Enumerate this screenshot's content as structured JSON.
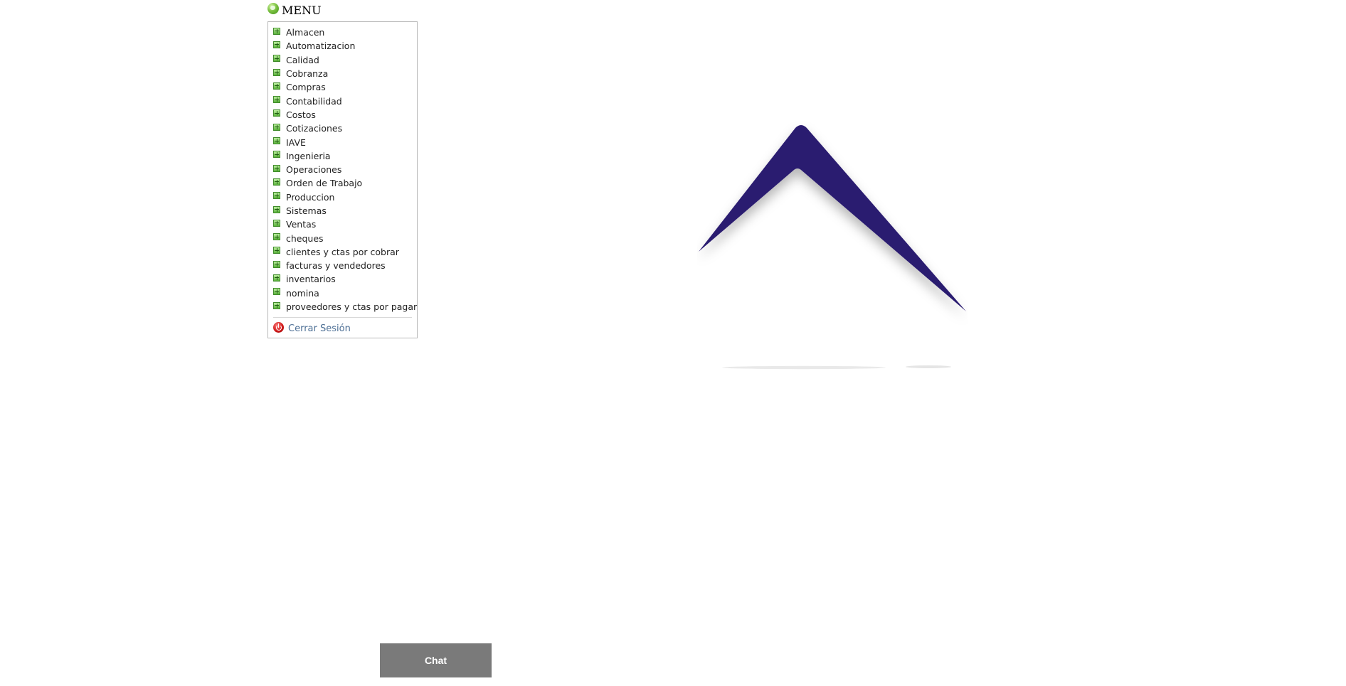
{
  "menu": {
    "title": "MENU",
    "items": [
      "Almacen",
      "Automatizacion",
      "Calidad",
      "Cobranza",
      "Compras",
      "Contabilidad",
      "Costos",
      "Cotizaciones",
      "IAVE",
      "Ingenieria",
      "Operaciones",
      "Orden de Trabajo",
      "Produccion",
      "Sistemas",
      "Ventas",
      "cheques",
      "clientes y ctas por cobrar",
      "facturas y vendedores",
      "inventarios",
      "nomina",
      "proveedores y ctas por pagar"
    ],
    "logout_label": "Cerrar Sesión"
  },
  "chat": {
    "label": "Chat"
  },
  "colors": {
    "logo": "#2a1a70",
    "chat_button": "#7a7a7a",
    "logout_link": "#4d6f95",
    "menu_border": "#b8b8b8"
  },
  "icons": {
    "menu": "globe-icon",
    "menu_item": "plus-box-icon",
    "logout": "power-icon"
  }
}
